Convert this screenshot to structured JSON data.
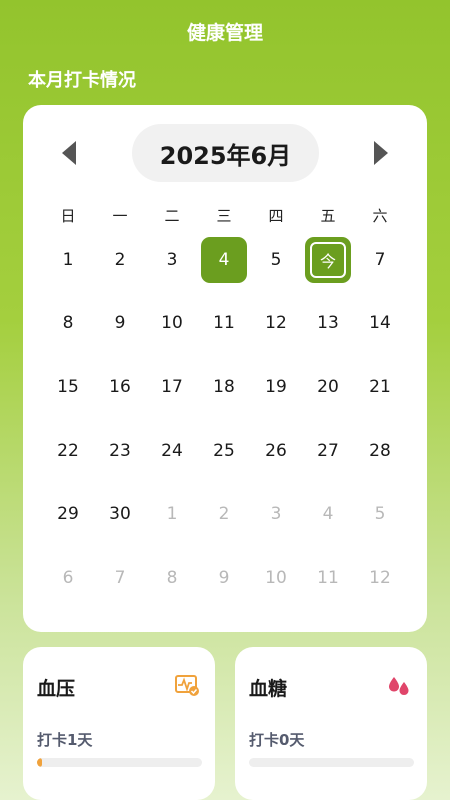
{
  "header": {
    "title": "健康管理"
  },
  "section": {
    "title": "本月打卡情况"
  },
  "calendar": {
    "month_label": "2025年6月",
    "weekdays": [
      "日",
      "一",
      "二",
      "三",
      "四",
      "五",
      "六"
    ],
    "days": [
      {
        "label": "1",
        "state": "current"
      },
      {
        "label": "2",
        "state": "current"
      },
      {
        "label": "3",
        "state": "current"
      },
      {
        "label": "4",
        "state": "selected"
      },
      {
        "label": "5",
        "state": "current"
      },
      {
        "label": "今",
        "state": "today"
      },
      {
        "label": "7",
        "state": "current"
      },
      {
        "label": "8",
        "state": "current"
      },
      {
        "label": "9",
        "state": "current"
      },
      {
        "label": "10",
        "state": "current"
      },
      {
        "label": "11",
        "state": "current"
      },
      {
        "label": "12",
        "state": "current"
      },
      {
        "label": "13",
        "state": "current"
      },
      {
        "label": "14",
        "state": "current"
      },
      {
        "label": "15",
        "state": "current"
      },
      {
        "label": "16",
        "state": "current"
      },
      {
        "label": "17",
        "state": "current"
      },
      {
        "label": "18",
        "state": "current"
      },
      {
        "label": "19",
        "state": "current"
      },
      {
        "label": "20",
        "state": "current"
      },
      {
        "label": "21",
        "state": "current"
      },
      {
        "label": "22",
        "state": "current"
      },
      {
        "label": "23",
        "state": "current"
      },
      {
        "label": "24",
        "state": "current"
      },
      {
        "label": "25",
        "state": "current"
      },
      {
        "label": "26",
        "state": "current"
      },
      {
        "label": "27",
        "state": "current"
      },
      {
        "label": "28",
        "state": "current"
      },
      {
        "label": "29",
        "state": "current"
      },
      {
        "label": "30",
        "state": "current"
      },
      {
        "label": "1",
        "state": "other"
      },
      {
        "label": "2",
        "state": "other"
      },
      {
        "label": "3",
        "state": "other"
      },
      {
        "label": "4",
        "state": "other"
      },
      {
        "label": "5",
        "state": "other"
      },
      {
        "label": "6",
        "state": "other"
      },
      {
        "label": "7",
        "state": "other"
      },
      {
        "label": "8",
        "state": "other"
      },
      {
        "label": "9",
        "state": "other"
      },
      {
        "label": "10",
        "state": "other"
      },
      {
        "label": "11",
        "state": "other"
      },
      {
        "label": "12",
        "state": "other"
      }
    ]
  },
  "stats": {
    "blood_pressure": {
      "title": "血压",
      "label": "打卡1天",
      "progress": 0.03,
      "icon": "heart-monitor-icon",
      "color": "#f0a23c"
    },
    "blood_sugar": {
      "title": "血糖",
      "label": "打卡0天",
      "progress": 0,
      "icon": "blood-drop-icon",
      "color": "#e0456a"
    }
  },
  "colors": {
    "accent": "#6b9e1f",
    "bg_top": "#93c42d"
  }
}
